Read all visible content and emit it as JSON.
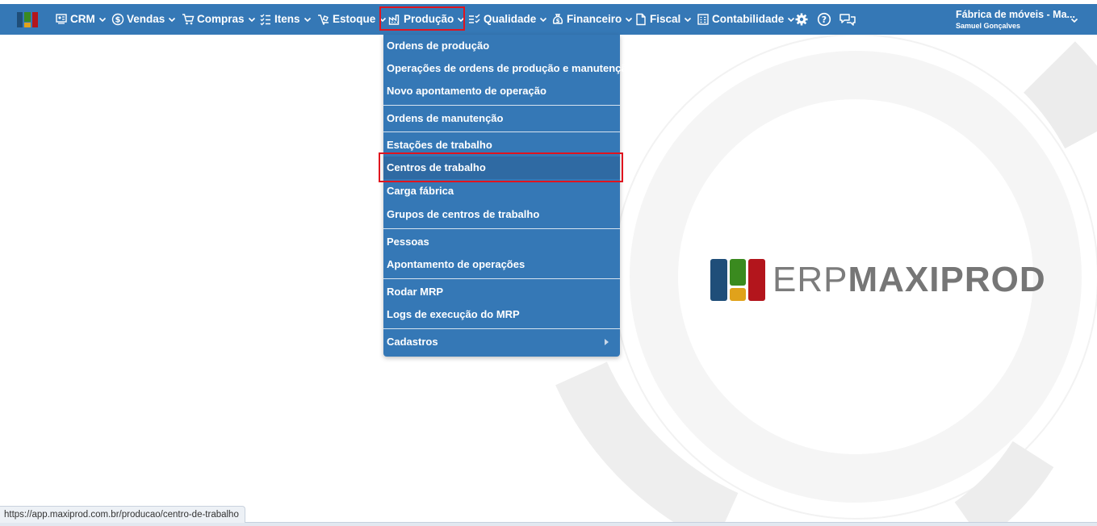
{
  "topnav": {
    "items": [
      {
        "label": "CRM",
        "icon": "crm-icon"
      },
      {
        "label": "Vendas",
        "icon": "dollar-icon"
      },
      {
        "label": "Compras",
        "icon": "cart-icon"
      },
      {
        "label": "Itens",
        "icon": "items-icon"
      },
      {
        "label": "Estoque",
        "icon": "stock-icon"
      },
      {
        "label": "Produção",
        "icon": "factory-icon"
      },
      {
        "label": "Qualidade",
        "icon": "quality-icon"
      },
      {
        "label": "Financeiro",
        "icon": "money-bag-icon"
      },
      {
        "label": "Fiscal",
        "icon": "fiscal-doc-icon"
      },
      {
        "label": "Contabilidade",
        "icon": "ledger-icon"
      }
    ],
    "company_name": "Fábrica de móveis - Ma...",
    "user_name": "Samuel Gonçalves"
  },
  "dropdown": {
    "items": [
      {
        "label": "Ordens de produção"
      },
      {
        "label": "Operações de ordens de produção e manutenção"
      },
      {
        "label": "Novo apontamento de operação"
      },
      {
        "label": "Ordens de manutenção"
      },
      {
        "label": "Estações de trabalho"
      },
      {
        "label": "Centros de trabalho"
      },
      {
        "label": "Carga fábrica"
      },
      {
        "label": "Grupos de centros de trabalho"
      },
      {
        "label": "Pessoas"
      },
      {
        "label": "Apontamento de operações"
      },
      {
        "label": "Rodar MRP"
      },
      {
        "label": "Logs de execução do MRP"
      },
      {
        "label": "Cadastros"
      }
    ]
  },
  "brand": {
    "light": "ERP",
    "bold": "MAXIPROD"
  },
  "status_url": "https://app.maxiprod.com.br/producao/centro-de-trabalho",
  "colors": {
    "nav_bg": "#3578b6",
    "highlight": "#e0141e",
    "logo_blue": "#1f4e79",
    "logo_green": "#3a8a1f",
    "logo_yellow": "#e0a21b",
    "logo_red": "#b3151c"
  }
}
